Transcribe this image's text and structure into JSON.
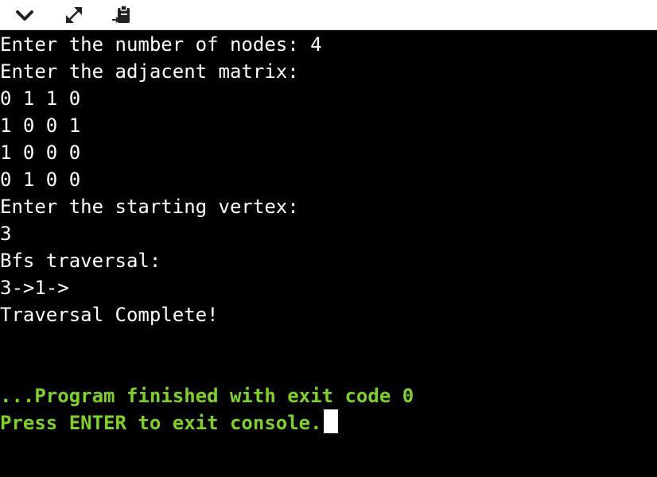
{
  "toolbar": {
    "icons": [
      "chevron-down-icon",
      "expand-icon",
      "paste-icon"
    ]
  },
  "console": {
    "lines": [
      "Enter the number of nodes: 4",
      "Enter the adjacent matrix:",
      "0 1 1 0",
      "1 0 0 1",
      "1 0 0 0",
      "0 1 0 0",
      "Enter the starting vertex:",
      "3",
      "Bfs traversal:",
      "3->1->",
      "Traversal Complete!"
    ],
    "finish_line": "...Program finished with exit code 0",
    "exit_prompt": "Press ENTER to exit console.",
    "status_color": "#7ed321"
  }
}
